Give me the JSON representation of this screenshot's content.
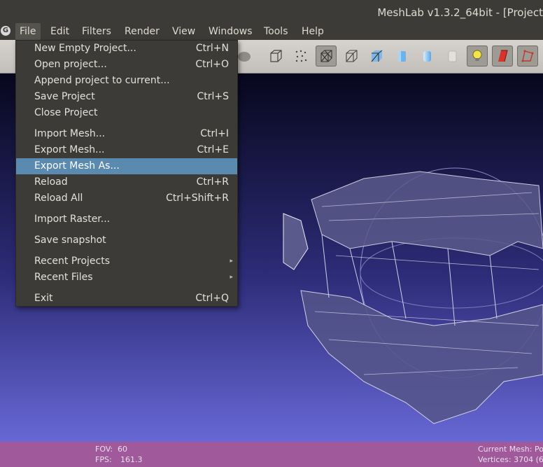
{
  "window": {
    "title": "MeshLab v1.3.2_64bit - [Project"
  },
  "menubar": {
    "app_icon": "meshlab-logo-icon",
    "items": [
      {
        "label": "File"
      },
      {
        "label": "Edit"
      },
      {
        "label": "Filters"
      },
      {
        "label": "Render"
      },
      {
        "label": "View"
      },
      {
        "label": "Windows"
      },
      {
        "label": "Tools"
      },
      {
        "label": "Help"
      }
    ]
  },
  "file_menu": {
    "items": [
      {
        "label": "New Empty Project...",
        "shortcut": "Ctrl+N"
      },
      {
        "label": "Open project...",
        "shortcut": "Ctrl+O"
      },
      {
        "label": "Append project to current...",
        "shortcut": ""
      },
      {
        "label": "Save Project",
        "shortcut": "Ctrl+S"
      },
      {
        "label": "Close Project",
        "shortcut": ""
      },
      {
        "label": "Import Mesh...",
        "shortcut": "Ctrl+I"
      },
      {
        "label": "Export Mesh...",
        "shortcut": "Ctrl+E"
      },
      {
        "label": "Export Mesh As...",
        "shortcut": "",
        "highlighted": true
      },
      {
        "label": "Reload",
        "shortcut": "Ctrl+R"
      },
      {
        "label": "Reload All",
        "shortcut": "Ctrl+Shift+R"
      },
      {
        "label": "Import Raster...",
        "shortcut": ""
      },
      {
        "label": "Save snapshot",
        "shortcut": ""
      },
      {
        "label": "Recent Projects",
        "submenu": true
      },
      {
        "label": "Recent Files",
        "submenu": true
      },
      {
        "label": "Exit",
        "shortcut": "Ctrl+Q"
      }
    ]
  },
  "toolbar": {
    "icons": [
      "bounding-box-icon",
      "points-icon",
      "wireframe-icon",
      "hidden-lines-icon",
      "flat-lines-icon",
      "flat-shading-icon",
      "smooth-shading-icon",
      "texture-icon",
      "light-bulb-icon",
      "fancy-lighting-icon",
      "backface-culling-icon"
    ],
    "pressed": [
      "wireframe-icon",
      "light-bulb-icon"
    ]
  },
  "status": {
    "fov_label": "FOV:",
    "fov_value": "60",
    "fps_label": "FPS:",
    "fps_value": "161.3",
    "current_mesh": "Current Mesh: Po",
    "vertices": "Vertices: 3704 (6"
  },
  "colors": {
    "status_bar": "#a0599a",
    "menu_highlight": "#5b8ab0",
    "viewport_top": "#07071d",
    "viewport_bottom": "#6868d6"
  }
}
